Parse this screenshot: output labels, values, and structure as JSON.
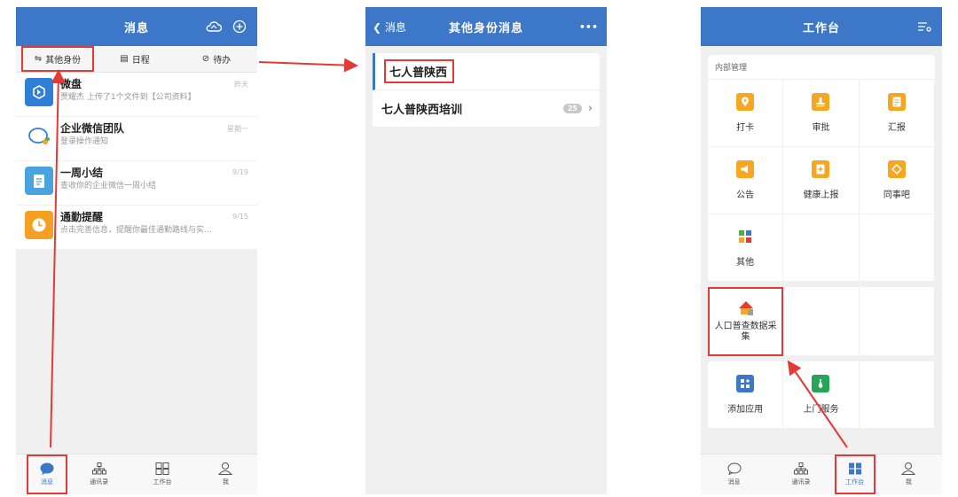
{
  "screen1": {
    "title": "消息",
    "tabs": [
      {
        "label": "其他身份",
        "icon": "switch-icon"
      },
      {
        "label": "日程",
        "icon": "calendar-icon"
      },
      {
        "label": "待办",
        "icon": "check-circle-icon"
      }
    ],
    "messages": [
      {
        "title": "微盘",
        "sub": "贾耀杰 上传了1个文件到【公司资料】",
        "time": "昨天",
        "color": "#2f7fd8",
        "icon": "drive-icon"
      },
      {
        "title": "企业微信团队",
        "sub": "登录操作通知",
        "time": "星期一",
        "color": "#ffffff",
        "icon": "chat-bubble-icon"
      },
      {
        "title": "一周小结",
        "sub": "查收你的企业微信一周小结",
        "time": "9/19",
        "color": "#4aa3df",
        "icon": "clipboard-icon"
      },
      {
        "title": "通勤提醒",
        "sub": "点击完善信息，提醒你最佳通勤路线与实…",
        "time": "9/15",
        "color": "#f5a023",
        "icon": "clock-icon"
      }
    ],
    "nav": [
      {
        "label": "消息",
        "icon": "message-icon"
      },
      {
        "label": "通讯录",
        "icon": "org-chart-icon"
      },
      {
        "label": "工作台",
        "icon": "grid-icon"
      },
      {
        "label": "我",
        "icon": "person-icon"
      }
    ]
  },
  "screen2": {
    "back_label": "消息",
    "title": "其他身份消息",
    "more": "•••",
    "rows": [
      {
        "label": "七人普陕西",
        "badge": ""
      },
      {
        "label": "七人普陕西培训",
        "badge": "25"
      }
    ]
  },
  "screen3": {
    "title": "工作台",
    "section": "内部管理",
    "apps": [
      {
        "label": "打卡",
        "color": "#f5a623",
        "icon": "location-pin-icon"
      },
      {
        "label": "审批",
        "color": "#f5a623",
        "icon": "stamp-icon"
      },
      {
        "label": "汇报",
        "color": "#f5a623",
        "icon": "document-icon"
      },
      {
        "label": "公告",
        "color": "#f5a623",
        "icon": "megaphone-icon"
      },
      {
        "label": "健康上报",
        "color": "#f5a623",
        "icon": "health-report-icon"
      },
      {
        "label": "同事吧",
        "color": "#f5a623",
        "icon": "diamond-icon"
      },
      {
        "label": "其他",
        "color": "#4caf50",
        "icon": "apps-icon"
      }
    ],
    "census_app": "人口普查数据采集",
    "extra_apps": [
      {
        "label": "添加应用",
        "color": "#3d77c8",
        "icon": "add-app-icon"
      },
      {
        "label": "上门服务",
        "color": "#27a35a",
        "icon": "tie-icon"
      }
    ],
    "nav": [
      {
        "label": "消息"
      },
      {
        "label": "通讯录"
      },
      {
        "label": "工作台"
      },
      {
        "label": "我"
      }
    ]
  },
  "colors": {
    "accent": "#3d77c8",
    "highlight": "#e53935"
  }
}
